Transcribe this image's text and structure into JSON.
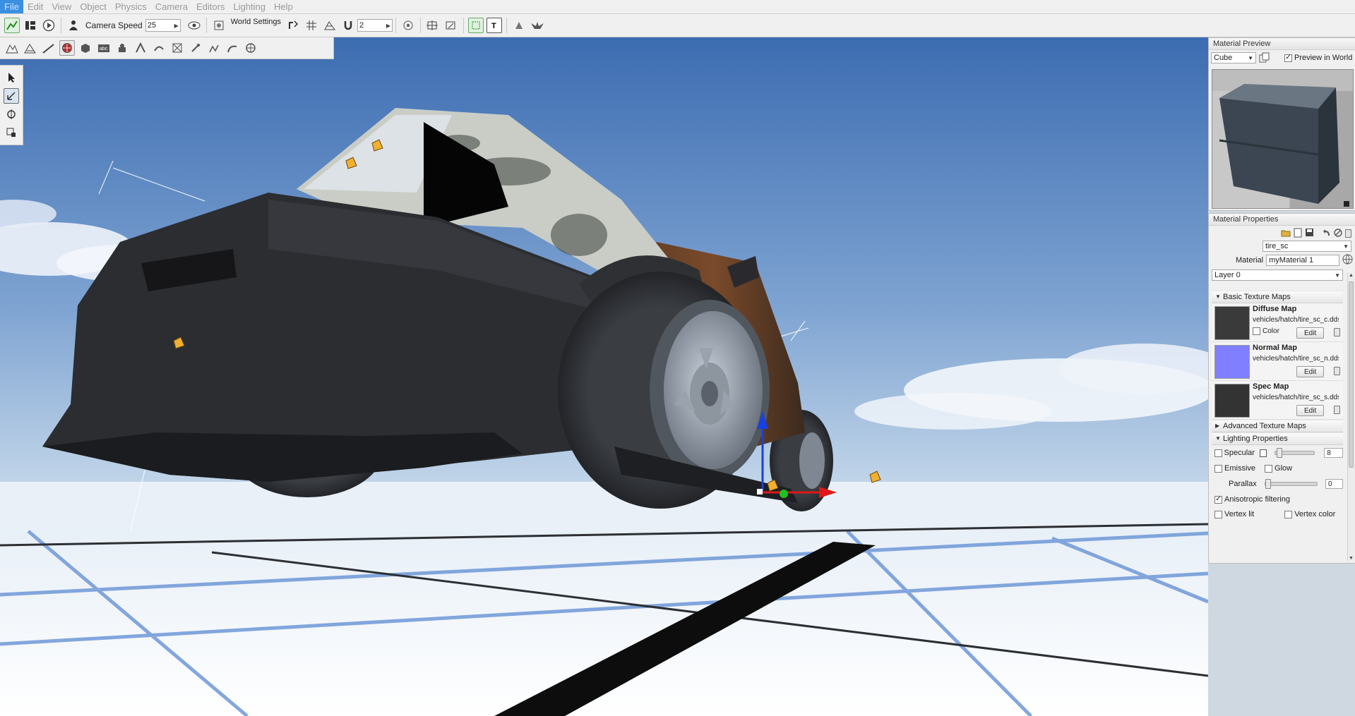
{
  "menu": [
    "File",
    "Edit",
    "View",
    "Object",
    "Physics",
    "Camera",
    "Editors",
    "Lighting",
    "Help"
  ],
  "toolbar": {
    "camera_speed_label": "Camera Speed",
    "camera_speed_value": "25",
    "world_settings_label": "World Settings",
    "snap_value": "2"
  },
  "material_preview": {
    "title": "Material Preview",
    "shape": "Cube",
    "preview_in_world_label": "Preview in World",
    "preview_in_world_checked": true
  },
  "material_properties": {
    "title": "Material Properties",
    "mapto_value": "tire_sc",
    "material_label": "Material",
    "material_value": "myMaterial 1",
    "layer": "Layer 0",
    "basic_texture_maps": "Basic Texture Maps",
    "maps": [
      {
        "name": "Diffuse Map",
        "path": "vehicles/hatch/tire_sc_c.dds",
        "color_label": "Color",
        "edit_label": "Edit",
        "thumb_color": "#3a3a3a"
      },
      {
        "name": "Normal Map",
        "path": "vehicles/hatch/tire_sc_n.dds",
        "edit_label": "Edit",
        "thumb_color": "#7f7fff"
      },
      {
        "name": "Spec Map",
        "path": "vehicles/hatch/tire_sc_s.dds",
        "edit_label": "Edit",
        "thumb_color": "#333333"
      }
    ],
    "advanced_texture_maps": "Advanced Texture Maps",
    "lighting_properties": "Lighting Properties",
    "specular_label": "Specular",
    "specular_value": "8",
    "emissive_label": "Emissive",
    "glow_label": "Glow",
    "parallax_label": "Parallax",
    "parallax_value": "0",
    "anisotropic_label": "Anisotropic filtering",
    "anisotropic_checked": true,
    "vertex_lit_label": "Vertex lit",
    "vertex_color_label": "Vertex color"
  },
  "colors": {
    "sky_top": "#3f6fb3",
    "sky_bottom": "#c4d7ea",
    "ground": "#f2f7fb",
    "grid_line": "#6b95d6",
    "accent": "#3a8fe0"
  }
}
